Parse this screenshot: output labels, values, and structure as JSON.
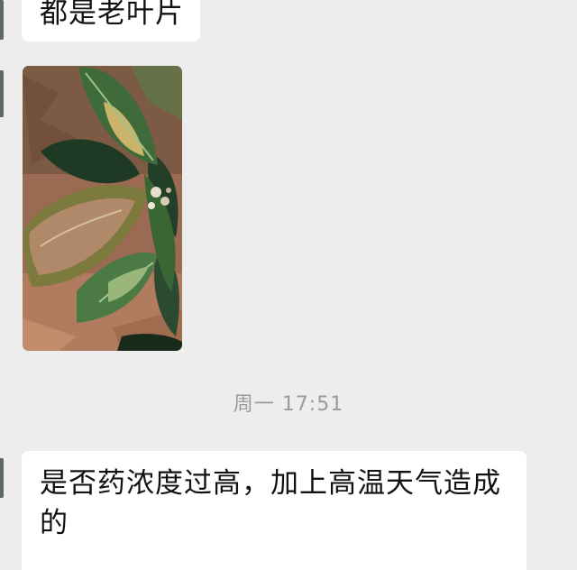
{
  "messages": {
    "top_text": "都是老叶片",
    "image_alt": "photo of plant leaves with brown scorched patches",
    "timestamp": "周一 17:51",
    "reply_text": "是否药浓度过高，加上高温天气造成的"
  },
  "colors": {
    "background": "#ededed",
    "bubble": "#ffffff",
    "text": "#111111",
    "timestamp": "#9a9a9a"
  }
}
